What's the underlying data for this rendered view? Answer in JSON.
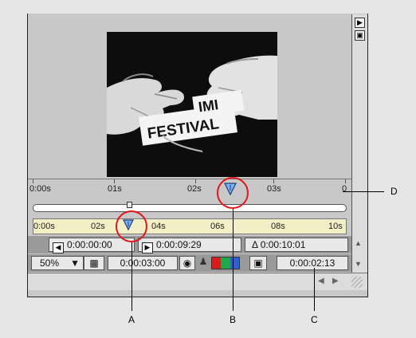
{
  "preview": {
    "sign_text": "FESTIVAL",
    "sign_partial": "IMI"
  },
  "timeline": {
    "ruler_labels": [
      "0:00s",
      "01s",
      "02s",
      "03s",
      "0"
    ],
    "mini_labels": [
      "0:00s",
      "02s",
      "04s",
      "06s",
      "08s",
      "10s"
    ]
  },
  "time_controls": {
    "in_point": "0:00:00:00",
    "out_point": "0:00:09:29",
    "duration": "Δ 0:00:10:01",
    "zoom": "50%",
    "current_time": "0:00:03:00",
    "region_time": "0:00:02:13"
  },
  "callouts": {
    "a": "A",
    "b": "B",
    "c": "C",
    "d": "D"
  },
  "colors": {
    "accent_red": "#e0161c",
    "marker_blue": "#3a7fd4",
    "mini_ruler": "#f2efc7"
  }
}
